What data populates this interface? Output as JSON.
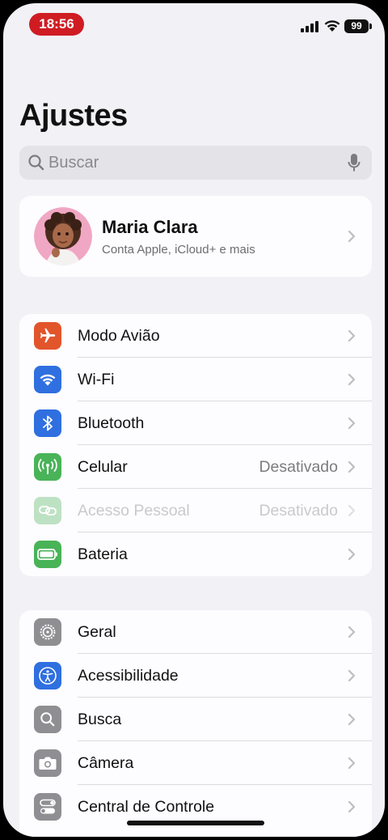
{
  "status_bar": {
    "time": "18:56",
    "battery": "99",
    "recording_color": "#cf1c23"
  },
  "title": "Ajustes",
  "search": {
    "placeholder": "Buscar",
    "icon": "magnifyingglass-icon",
    "mic_icon": "microphone-icon"
  },
  "profile": {
    "name": "Maria Clara",
    "subtitle": "Conta Apple, iCloud+ e mais",
    "avatar_icon": "memoji-avatar"
  },
  "connectivity": [
    {
      "label": "Modo Avião",
      "value": "",
      "icon": "airplane-icon",
      "color": "#e2552b",
      "enabled": true
    },
    {
      "label": "Wi-Fi",
      "value": "",
      "icon": "wifi-icon",
      "color": "#2f6fe0",
      "enabled": true
    },
    {
      "label": "Bluetooth",
      "value": "",
      "icon": "bluetooth-icon",
      "color": "#2f6fe0",
      "enabled": true
    },
    {
      "label": "Celular",
      "value": "Desativado",
      "icon": "antenna-icon",
      "color": "#49b358",
      "enabled": true
    },
    {
      "label": "Acesso Pessoal",
      "value": "Desativado",
      "icon": "personal-hotspot-icon",
      "color": "#49b358",
      "enabled": false
    },
    {
      "label": "Bateria",
      "value": "",
      "icon": "battery-icon",
      "color": "#49b358",
      "enabled": true
    }
  ],
  "general": [
    {
      "label": "Geral",
      "icon": "gear-icon",
      "color": "#8e8e93"
    },
    {
      "label": "Acessibilidade",
      "icon": "accessibility-icon",
      "color": "#2f6fe0"
    },
    {
      "label": "Busca",
      "icon": "search-icon",
      "color": "#8e8e93"
    },
    {
      "label": "Câmera",
      "icon": "camera-icon",
      "color": "#8e8e93"
    },
    {
      "label": "Central de Controle",
      "icon": "control-center-icon",
      "color": "#8e8e93"
    }
  ]
}
